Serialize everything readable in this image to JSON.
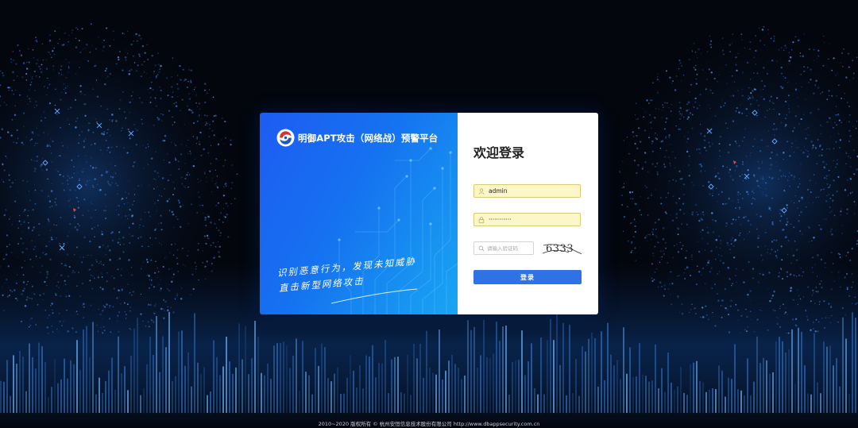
{
  "brand": {
    "title": "明御APT攻击（网络战）预警平台",
    "logo_icon": "shield-swirl-logo"
  },
  "slogan": {
    "line1": "识别恶意行为，发现未知威胁",
    "line2": "直击新型网络攻击"
  },
  "login": {
    "title": "欢迎登录",
    "username_value": "admin",
    "password_value": "············",
    "captcha_placeholder": "请输入验证码",
    "captcha_code": "6333",
    "submit_label": "登录"
  },
  "footer": {
    "copyright": "2010~2020 版权所有 © 杭州安恒信息技术股份有限公司 http://www.dbappsecurity.com.cn"
  },
  "colors": {
    "panel_gradient_start": "#1e5cf2",
    "panel_gradient_end": "#18a6f2",
    "button": "#2e72e6",
    "autofill_bg": "#fbf7c8",
    "page_bg": "#03060d"
  }
}
